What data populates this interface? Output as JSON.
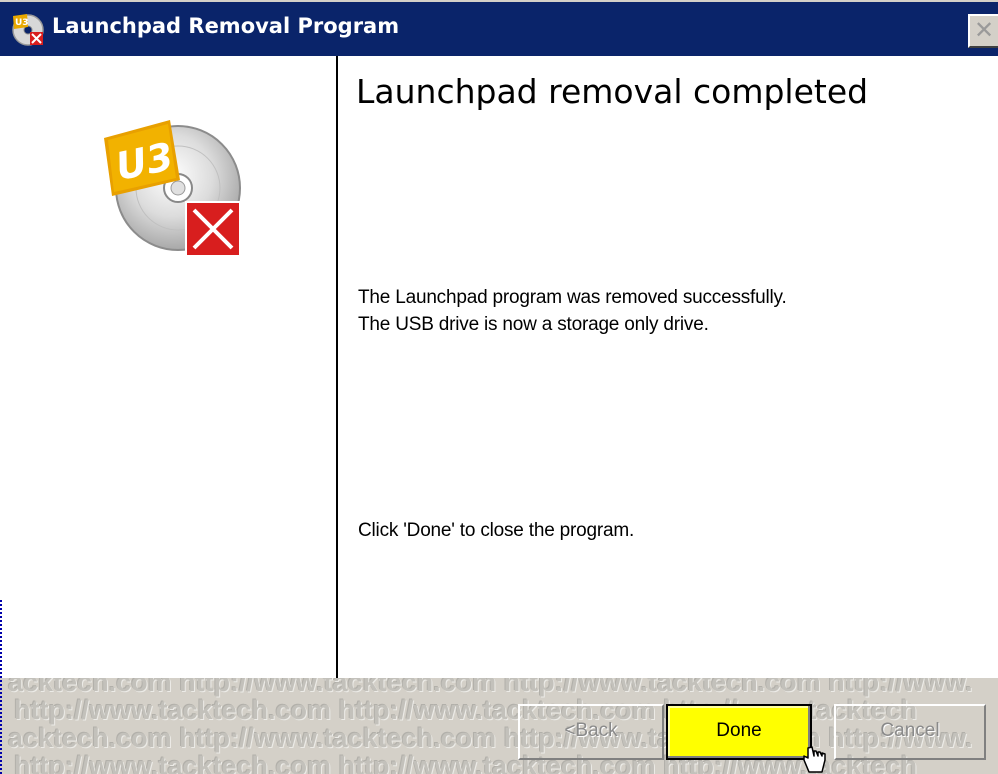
{
  "window": {
    "title": "Launchpad Removal Program",
    "close_glyph": "✕",
    "colors": {
      "titlebar": "#0a246a",
      "done_button": "#ffff00",
      "dialog_face": "#d4d0c8"
    }
  },
  "hero": {
    "icon": "u3-cd-remove-icon",
    "badge_text": "U3"
  },
  "content": {
    "heading": "Launchpad removal completed",
    "line1": "The Launchpad program was removed successfully.",
    "line2": "The USB drive is now a storage only drive.",
    "line3": "Click 'Done' to close the program."
  },
  "watermark": {
    "line1": "acktech.com http://www.tacktech.com http://www.tacktech.com http://www.",
    "line2": "http://www.tacktech.com http://www.tacktech.com http://www.tacktech",
    "line3": "acktech.com http://www.tacktech.com http://www.tacktech.com http://www.",
    "line4": "http://www.tacktech.com http://www.tacktech.com http://www.tacktech"
  },
  "buttons": {
    "back": "<Back",
    "done": "Done",
    "cancel": "Cancel"
  }
}
